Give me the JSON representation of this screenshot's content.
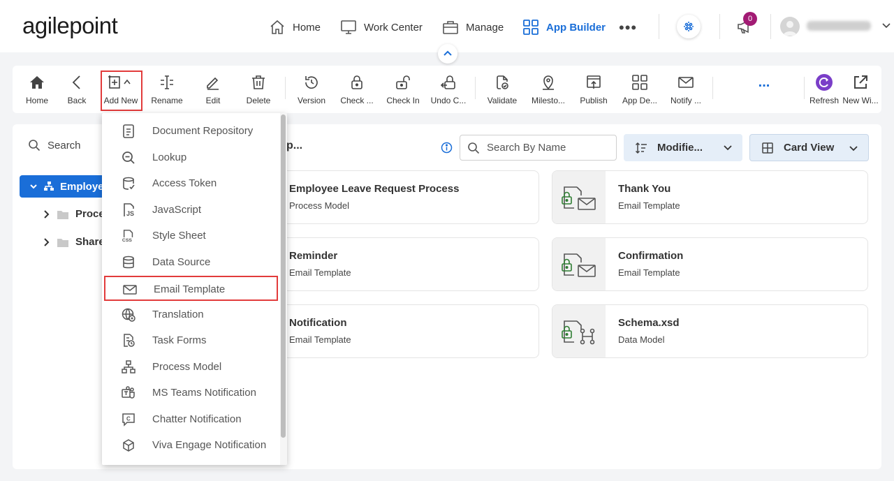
{
  "brand": {
    "logo_text": "agilepoint"
  },
  "nav": {
    "items": [
      {
        "label": "Home",
        "icon": "home-icon"
      },
      {
        "label": "Work Center",
        "icon": "monitor-icon"
      },
      {
        "label": "Manage",
        "icon": "briefcase-icon"
      },
      {
        "label": "App Builder",
        "icon": "grid-icon",
        "active": true
      }
    ],
    "more": "•••",
    "notification_count": "0"
  },
  "toolbar": {
    "items": [
      {
        "label": "Home",
        "icon": "home-icon"
      },
      {
        "label": "Back",
        "icon": "chevron-left-icon"
      },
      {
        "label": "Add New",
        "icon": "add-new-icon"
      },
      {
        "label": "Rename",
        "icon": "rename-icon"
      },
      {
        "label": "Edit",
        "icon": "pencil-icon"
      },
      {
        "label": "Delete",
        "icon": "trash-icon"
      },
      {
        "label": "Version",
        "icon": "history-icon"
      },
      {
        "label": "Check ...",
        "icon": "lock-icon"
      },
      {
        "label": "Check In",
        "icon": "unlock-icon"
      },
      {
        "label": "Undo C...",
        "icon": "undo-checkout-icon"
      },
      {
        "label": "Validate",
        "icon": "validate-icon"
      },
      {
        "label": "Milesto...",
        "icon": "milestone-icon"
      },
      {
        "label": "Publish",
        "icon": "publish-icon"
      },
      {
        "label": "App De...",
        "icon": "app-design-icon"
      },
      {
        "label": "Notify ...",
        "icon": "mail-icon"
      },
      {
        "label": "...",
        "icon": "more-icon"
      },
      {
        "label": "Refresh",
        "icon": "refresh-icon"
      },
      {
        "label": "New Wi...",
        "icon": "new-window-icon"
      }
    ]
  },
  "sidebar": {
    "search_label": "Search",
    "tree": [
      {
        "label": "Employe",
        "selected": true
      },
      {
        "label": "Proce"
      },
      {
        "label": "Share"
      }
    ]
  },
  "main": {
    "title": "p...",
    "search_placeholder": "Search By Name",
    "sort_label": "Modifie...",
    "view_label": "Card View",
    "cards": [
      {
        "title": "Employee Leave Request Process",
        "subtitle": "Process Model",
        "icon": "process-model-icon"
      },
      {
        "title": "Thank You",
        "subtitle": "Email Template",
        "icon": "email-template-icon"
      },
      {
        "title": "Reminder",
        "subtitle": "Email Template",
        "icon": "email-template-icon"
      },
      {
        "title": "Confirmation",
        "subtitle": "Email Template",
        "icon": "email-template-icon"
      },
      {
        "title": "Notification",
        "subtitle": "Email Template",
        "icon": "email-template-icon"
      },
      {
        "title": "Schema.xsd",
        "subtitle": "Data Model",
        "icon": "data-model-icon"
      }
    ]
  },
  "add_new_menu": {
    "items": [
      {
        "label": "Document Repository",
        "icon": "document-icon"
      },
      {
        "label": "Lookup",
        "icon": "lookup-icon"
      },
      {
        "label": "Access Token",
        "icon": "access-token-icon"
      },
      {
        "label": "JavaScript",
        "icon": "javascript-icon"
      },
      {
        "label": "Style Sheet",
        "icon": "css-icon"
      },
      {
        "label": "Data Source",
        "icon": "database-icon"
      },
      {
        "label": "Email Template",
        "icon": "mail-icon",
        "highlighted": true
      },
      {
        "label": "Translation",
        "icon": "globe-icon"
      },
      {
        "label": "Task Forms",
        "icon": "task-forms-icon"
      },
      {
        "label": "Process Model",
        "icon": "process-model-icon"
      },
      {
        "label": "MS Teams Notification",
        "icon": "teams-icon"
      },
      {
        "label": "Chatter Notification",
        "icon": "chatter-icon"
      },
      {
        "label": "Viva Engage Notification",
        "icon": "viva-engage-icon"
      }
    ]
  },
  "colors": {
    "accent": "#1a6ed8",
    "highlight_border": "#e23b3b",
    "badge": "#a21b74",
    "lock_green": "#2e7d32"
  }
}
